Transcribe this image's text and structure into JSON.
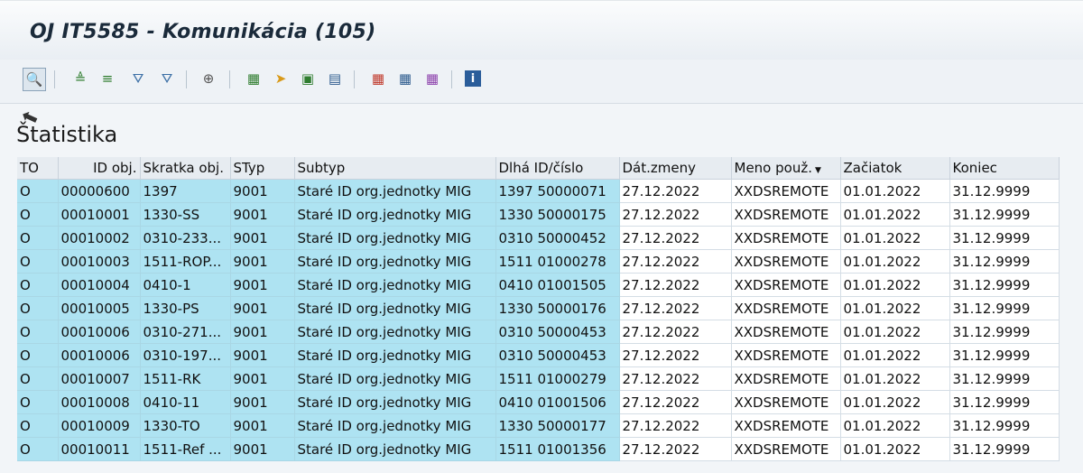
{
  "window": {
    "title": "OJ IT5585 - Komunikácia (105)"
  },
  "toolbar": {
    "icons": [
      "details-icon",
      "sort-ascending-icon",
      "sort-descending-icon",
      "filter-icon",
      "delete-filter-icon",
      "subtotal-icon",
      "export-excel-icon",
      "export-icon",
      "send-icon",
      "print-preview-icon",
      "select-layout-icon",
      "change-layout-icon",
      "save-layout-icon",
      "info-icon"
    ]
  },
  "section": {
    "heading": "Štatistika"
  },
  "table": {
    "headers": [
      "TO",
      "ID obj.",
      "Skratka obj.",
      "STyp",
      "Subtyp",
      "Dlhá ID/číslo",
      "Dát.zmeny",
      "Meno použ.",
      "Začiatok",
      "Koniec"
    ],
    "rows": [
      [
        "O",
        "00000600",
        "1397",
        "9001",
        "Staré ID org.jednotky MIG",
        "1397 50000071",
        "27.12.2022",
        "XXDSREMOTE",
        "01.01.2022",
        "31.12.9999"
      ],
      [
        "O",
        "00010001",
        "1330-SS",
        "9001",
        "Staré ID org.jednotky MIG",
        "1330 50000175",
        "27.12.2022",
        "XXDSREMOTE",
        "01.01.2022",
        "31.12.9999"
      ],
      [
        "O",
        "00010002",
        "0310-233...",
        "9001",
        "Staré ID org.jednotky MIG",
        "0310 50000452",
        "27.12.2022",
        "XXDSREMOTE",
        "01.01.2022",
        "31.12.9999"
      ],
      [
        "O",
        "00010003",
        "1511-ROP...",
        "9001",
        "Staré ID org.jednotky MIG",
        "1511 01000278",
        "27.12.2022",
        "XXDSREMOTE",
        "01.01.2022",
        "31.12.9999"
      ],
      [
        "O",
        "00010004",
        "0410-1",
        "9001",
        "Staré ID org.jednotky MIG",
        "0410 01001505",
        "27.12.2022",
        "XXDSREMOTE",
        "01.01.2022",
        "31.12.9999"
      ],
      [
        "O",
        "00010005",
        "1330-PS",
        "9001",
        "Staré ID org.jednotky MIG",
        "1330 50000176",
        "27.12.2022",
        "XXDSREMOTE",
        "01.01.2022",
        "31.12.9999"
      ],
      [
        "O",
        "00010006",
        "0310-271...",
        "9001",
        "Staré ID org.jednotky MIG",
        "0310 50000453",
        "27.12.2022",
        "XXDSREMOTE",
        "01.01.2022",
        "31.12.9999"
      ],
      [
        "O",
        "00010006",
        "0310-197...",
        "9001",
        "Staré ID org.jednotky MIG",
        "0310 50000453",
        "27.12.2022",
        "XXDSREMOTE",
        "01.01.2022",
        "31.12.9999"
      ],
      [
        "O",
        "00010007",
        "1511-RK",
        "9001",
        "Staré ID org.jednotky MIG",
        "1511 01000279",
        "27.12.2022",
        "XXDSREMOTE",
        "01.01.2022",
        "31.12.9999"
      ],
      [
        "O",
        "00010008",
        "0410-11",
        "9001",
        "Staré ID org.jednotky MIG",
        "0410 01001506",
        "27.12.2022",
        "XXDSREMOTE",
        "01.01.2022",
        "31.12.9999"
      ],
      [
        "O",
        "00010009",
        "1330-TO",
        "9001",
        "Staré ID org.jednotky MIG",
        "1330 50000177",
        "27.12.2022",
        "XXDSREMOTE",
        "01.01.2022",
        "31.12.9999"
      ],
      [
        "O",
        "00010011",
        "1511-Ref ...",
        "9001",
        "Staré ID org.jednotky MIG",
        "1511 01001356",
        "27.12.2022",
        "XXDSREMOTE",
        "01.01.2022",
        "31.12.9999"
      ]
    ]
  }
}
